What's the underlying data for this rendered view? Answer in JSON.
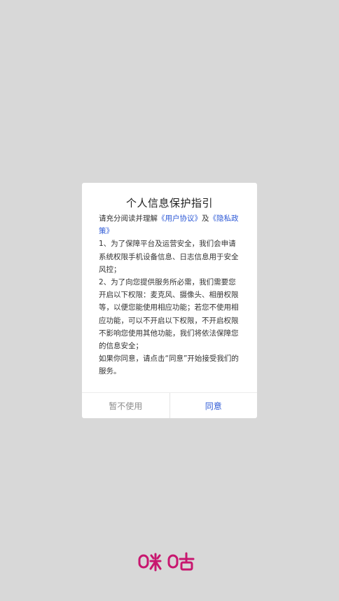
{
  "dialog": {
    "title": "个人信息保护指引",
    "intro_prefix": "请充分阅读并理解",
    "user_agreement_link": "《用户协议》",
    "intro_and": "及",
    "privacy_policy_link": "《隐私政策》",
    "paragraph1": "1、为了保障平台及运营安全，我们会申请系统权限手机设备信息、日志信息用于安全风控；",
    "paragraph2": "2、为了向您提供服务所必需，我们需要您开启以下权限：麦克风、摄像头、相册权限等，以便您能使用相应功能；若您不使用相应功能，可以不开启以下权限，不开启权限不影响您使用其他功能，我们将依法保障您的信息安全；",
    "paragraph3": "如果你同意，请点击“同意”开始接受我们的服务。",
    "decline_label": "暂不使用",
    "agree_label": "同意"
  },
  "brand": {
    "logo_text": "咪咕",
    "logo_color": "#c8176f"
  },
  "colors": {
    "background": "#d8d8d8",
    "link": "#2d59d6",
    "muted": "#8c8c8c"
  }
}
